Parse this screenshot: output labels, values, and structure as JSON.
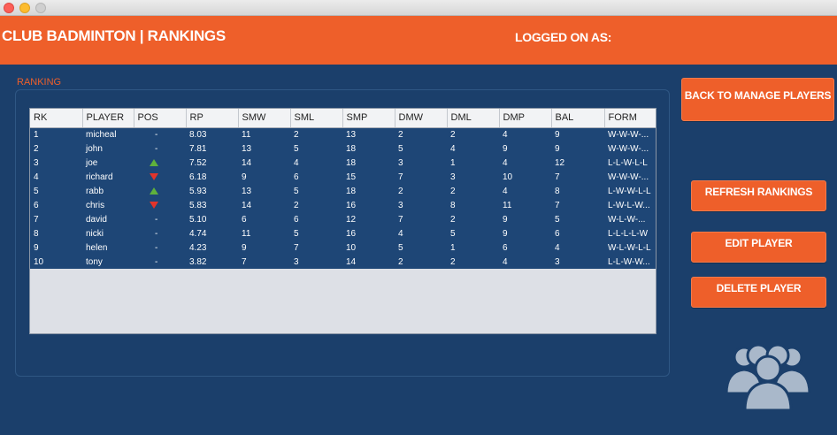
{
  "window": {
    "controls": [
      "close",
      "minimize",
      "zoom"
    ]
  },
  "header": {
    "title": "CLUB BADMINTON | RANKINGS",
    "logged_on_label": "LOGGED ON AS:"
  },
  "rankings": {
    "label": "RANKING",
    "columns": [
      "RK",
      "PLAYER",
      "POS",
      "RP",
      "SMW",
      "SML",
      "SMP",
      "DMW",
      "DML",
      "DMP",
      "BAL",
      "FORM"
    ],
    "rows": [
      {
        "rk": "1",
        "player": "micheal",
        "pos": "-",
        "rp": "8.03",
        "smw": "11",
        "sml": "2",
        "smp": "13",
        "dmw": "2",
        "dml": "2",
        "dmp": "4",
        "bal": "9",
        "form": "W-W-W-..."
      },
      {
        "rk": "2",
        "player": "john",
        "pos": "-",
        "rp": "7.81",
        "smw": "13",
        "sml": "5",
        "smp": "18",
        "dmw": "5",
        "dml": "4",
        "dmp": "9",
        "bal": "9",
        "form": "W-W-W-..."
      },
      {
        "rk": "3",
        "player": "joe",
        "pos": "up",
        "rp": "7.52",
        "smw": "14",
        "sml": "4",
        "smp": "18",
        "dmw": "3",
        "dml": "1",
        "dmp": "4",
        "bal": "12",
        "form": "L-L-W-L-L"
      },
      {
        "rk": "4",
        "player": "richard",
        "pos": "down",
        "rp": "6.18",
        "smw": "9",
        "sml": "6",
        "smp": "15",
        "dmw": "7",
        "dml": "3",
        "dmp": "10",
        "bal": "7",
        "form": "W-W-W-..."
      },
      {
        "rk": "5",
        "player": "rabb",
        "pos": "up",
        "rp": "5.93",
        "smw": "13",
        "sml": "5",
        "smp": "18",
        "dmw": "2",
        "dml": "2",
        "dmp": "4",
        "bal": "8",
        "form": "L-W-W-L-L"
      },
      {
        "rk": "6",
        "player": "chris",
        "pos": "down",
        "rp": "5.83",
        "smw": "14",
        "sml": "2",
        "smp": "16",
        "dmw": "3",
        "dml": "8",
        "dmp": "11",
        "bal": "7",
        "form": "L-W-L-W..."
      },
      {
        "rk": "7",
        "player": "david",
        "pos": "-",
        "rp": "5.10",
        "smw": "6",
        "sml": "6",
        "smp": "12",
        "dmw": "7",
        "dml": "2",
        "dmp": "9",
        "bal": "5",
        "form": "W-L-W-..."
      },
      {
        "rk": "8",
        "player": "nicki",
        "pos": "-",
        "rp": "4.74",
        "smw": "11",
        "sml": "5",
        "smp": "16",
        "dmw": "4",
        "dml": "5",
        "dmp": "9",
        "bal": "6",
        "form": "L-L-L-L-W"
      },
      {
        "rk": "9",
        "player": "helen",
        "pos": "-",
        "rp": "4.23",
        "smw": "9",
        "sml": "7",
        "smp": "10",
        "dmw": "5",
        "dml": "1",
        "dmp": "6",
        "bal": "4",
        "form": "W-L-W-L-L"
      },
      {
        "rk": "10",
        "player": "tony",
        "pos": "-",
        "rp": "3.82",
        "smw": "7",
        "sml": "3",
        "smp": "14",
        "dmw": "2",
        "dml": "2",
        "dmp": "4",
        "bal": "3",
        "form": "L-L-W-W..."
      }
    ]
  },
  "buttons": {
    "back": "BACK TO MANAGE PLAYERS",
    "refresh": "REFRESH RANKINGS",
    "edit": "EDIT PLAYER",
    "delete": "DELETE PLAYER"
  },
  "icons": {
    "users": "users-group-icon",
    "pos_up": "arrow-up-icon",
    "pos_down": "arrow-down-icon"
  },
  "colors": {
    "accent": "#ee5f2a",
    "background": "#1b3f6b",
    "row": "#1e4676",
    "up": "#5fb13c",
    "down": "#e2342b"
  }
}
